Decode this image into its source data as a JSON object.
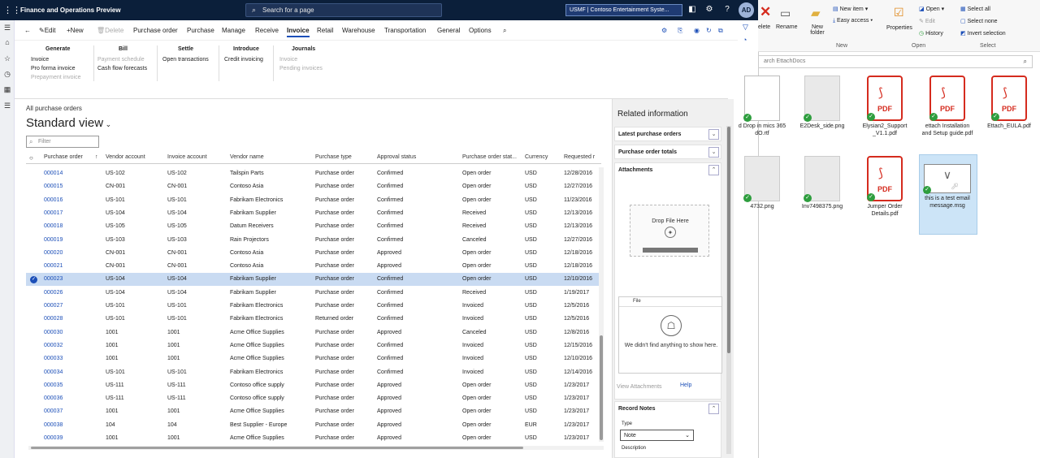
{
  "app": {
    "title": "Finance and Operations Preview",
    "search_placeholder": "Search for a page",
    "company": "USMF | Contoso Entertainment Syste...",
    "avatar": "AD"
  },
  "actionbar": {
    "edit": "Edit",
    "new": "New",
    "delete": "Delete",
    "tabs": [
      "Purchase order",
      "Purchase",
      "Manage",
      "Receive",
      "Invoice",
      "Retail",
      "Warehouse",
      "Transportation",
      "General",
      "Options"
    ],
    "selected_tab": "Invoice"
  },
  "ribbon": {
    "groups": [
      {
        "title": "Generate",
        "items": [
          "Invoice",
          "Pro forma invoice",
          "Prepayment invoice"
        ],
        "disabled": [
          false,
          false,
          true
        ]
      },
      {
        "title": "Bill",
        "items": [
          "Payment schedule",
          "Cash flow forecasts"
        ],
        "disabled": [
          true,
          false
        ]
      },
      {
        "title": "Settle",
        "items": [
          "Open transactions"
        ],
        "disabled": [
          false
        ]
      },
      {
        "title": "Introduce",
        "items": [
          "Credit invoicing"
        ],
        "disabled": [
          false
        ]
      },
      {
        "title": "Journals",
        "items": [
          "Invoice",
          "Pending invoices"
        ],
        "disabled": [
          true,
          true
        ]
      }
    ]
  },
  "list": {
    "breadcrumb": "All purchase orders",
    "view_title": "Standard view",
    "filter_placeholder": "Filter",
    "columns": [
      "Purchase order",
      "Vendor account",
      "Invoice account",
      "Vendor name",
      "Purchase type",
      "Approval status",
      "Purchase order stat...",
      "Currency",
      "Requested r"
    ],
    "rows": [
      [
        "000014",
        "US-102",
        "US-102",
        "Tailspin Parts",
        "Purchase order",
        "Confirmed",
        "Open order",
        "USD",
        "12/28/2016"
      ],
      [
        "000015",
        "CN-001",
        "CN-001",
        "Contoso Asia",
        "Purchase order",
        "Confirmed",
        "Open order",
        "USD",
        "12/27/2016"
      ],
      [
        "000016",
        "US-101",
        "US-101",
        "Fabrikam Electronics",
        "Purchase order",
        "Confirmed",
        "Open order",
        "USD",
        "11/23/2016"
      ],
      [
        "000017",
        "US-104",
        "US-104",
        "Fabrikam Supplier",
        "Purchase order",
        "Confirmed",
        "Received",
        "USD",
        "12/13/2016"
      ],
      [
        "000018",
        "US-105",
        "US-105",
        "Datum Receivers",
        "Purchase order",
        "Confirmed",
        "Received",
        "USD",
        "12/13/2016"
      ],
      [
        "000019",
        "US-103",
        "US-103",
        "Rain Projectors",
        "Purchase order",
        "Confirmed",
        "Canceled",
        "USD",
        "12/27/2016"
      ],
      [
        "000020",
        "CN-001",
        "CN-001",
        "Contoso Asia",
        "Purchase order",
        "Approved",
        "Open order",
        "USD",
        "12/18/2016"
      ],
      [
        "000021",
        "CN-001",
        "CN-001",
        "Contoso Asia",
        "Purchase order",
        "Approved",
        "Open order",
        "USD",
        "12/18/2016"
      ],
      [
        "000023",
        "US-104",
        "US-104",
        "Fabrikam Supplier",
        "Purchase order",
        "Confirmed",
        "Open order",
        "USD",
        "12/10/2016"
      ],
      [
        "000026",
        "US-104",
        "US-104",
        "Fabrikam Supplier",
        "Purchase order",
        "Confirmed",
        "Received",
        "USD",
        "1/19/2017"
      ],
      [
        "000027",
        "US-101",
        "US-101",
        "Fabrikam Electronics",
        "Purchase order",
        "Confirmed",
        "Invoiced",
        "USD",
        "12/5/2016"
      ],
      [
        "000028",
        "US-101",
        "US-101",
        "Fabrikam Electronics",
        "Returned order",
        "Confirmed",
        "Invoiced",
        "USD",
        "12/5/2016"
      ],
      [
        "000030",
        "1001",
        "1001",
        "Acme Office Supplies",
        "Purchase order",
        "Approved",
        "Canceled",
        "USD",
        "12/8/2016"
      ],
      [
        "000032",
        "1001",
        "1001",
        "Acme Office Supplies",
        "Purchase order",
        "Confirmed",
        "Invoiced",
        "USD",
        "12/15/2016"
      ],
      [
        "000033",
        "1001",
        "1001",
        "Acme Office Supplies",
        "Purchase order",
        "Confirmed",
        "Invoiced",
        "USD",
        "12/10/2016"
      ],
      [
        "000034",
        "US-101",
        "US-101",
        "Fabrikam Electronics",
        "Purchase order",
        "Confirmed",
        "Invoiced",
        "USD",
        "12/14/2016"
      ],
      [
        "000035",
        "US-111",
        "US-111",
        "Contoso office supply",
        "Purchase order",
        "Approved",
        "Open order",
        "USD",
        "1/23/2017"
      ],
      [
        "000036",
        "US-111",
        "US-111",
        "Contoso office supply",
        "Purchase order",
        "Approved",
        "Open order",
        "USD",
        "1/23/2017"
      ],
      [
        "000037",
        "1001",
        "1001",
        "Acme Office Supplies",
        "Purchase order",
        "Approved",
        "Open order",
        "USD",
        "1/23/2017"
      ],
      [
        "000038",
        "104",
        "104",
        "Best Supplier - Europe",
        "Purchase order",
        "Approved",
        "Open order",
        "EUR",
        "1/23/2017"
      ],
      [
        "000039",
        "1001",
        "1001",
        "Acme Office Supplies",
        "Purchase order",
        "Approved",
        "Open order",
        "USD",
        "1/23/2017"
      ]
    ],
    "selected_row": 8
  },
  "related": {
    "title": "Related information",
    "sections": [
      "Latest purchase orders",
      "Purchase order totals",
      "Attachments"
    ],
    "drop_label": "Drop File Here",
    "file_header": "File",
    "empty_message": "We didn't find anything to show here.",
    "view_attachments": "View Attachments",
    "help": "Help",
    "record_notes": "Record Notes",
    "type_label": "Type",
    "type_value": "Note",
    "description_label": "Description"
  },
  "explorer": {
    "ribbon": {
      "delete": "elete",
      "rename": "Rename",
      "new_folder": "New folder",
      "new_item": "New item",
      "easy_access": "Easy access",
      "properties": "Properties",
      "open": "Open",
      "edit": "Edit",
      "history": "History",
      "select_all": "Select all",
      "select_none": "Select none",
      "invert_selection": "Invert selection",
      "groups": [
        "New",
        "Open",
        "Select"
      ]
    },
    "search_placeholder": "arch EttachDocs",
    "files": [
      {
        "name": "d Drop in mics 365 dO.rtf",
        "kind": "doc"
      },
      {
        "name": "E2Desk_side.png",
        "kind": "image"
      },
      {
        "name": "Elysian2_Support _V1.1.pdf",
        "kind": "pdf"
      },
      {
        "name": "ettach Installation and Setup guide.pdf",
        "kind": "pdf"
      },
      {
        "name": "Ettach_EULA.pdf",
        "kind": "pdf"
      },
      {
        "name": "4732.png",
        "kind": "image"
      },
      {
        "name": "Inv7498375.png",
        "kind": "image"
      },
      {
        "name": "Jumper Order Details.pdf",
        "kind": "pdf"
      },
      {
        "name": "this is a test email message.msg",
        "kind": "msg"
      }
    ],
    "pdf_label": "PDF"
  }
}
